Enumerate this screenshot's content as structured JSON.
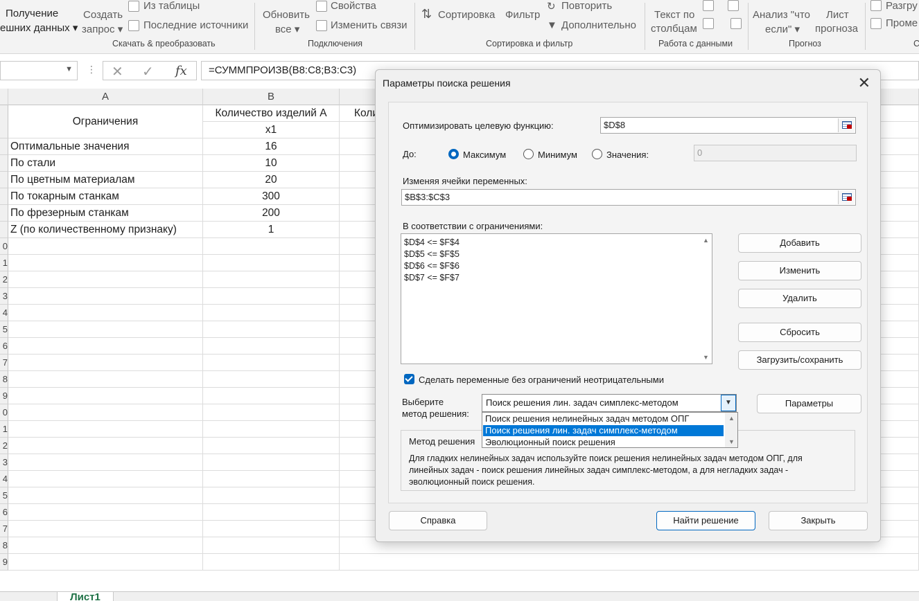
{
  "ribbon": {
    "get_data_line1": "Получение",
    "get_data_line2": "ешних данных",
    "create_query_line1": "Создать",
    "create_query_line2": "запрос",
    "from_table": "Из таблицы",
    "recent_sources": "Последние источники",
    "group_get_transform": "Скачать & преобразовать",
    "refresh_line1": "Обновить",
    "refresh_line2": "все",
    "properties": "Свойства",
    "edit_links": "Изменить связи",
    "group_connections": "Подключения",
    "sort": "Сортировка",
    "filter": "Фильтр",
    "reapply": "Повторить",
    "advanced": "Дополнительно",
    "group_sort_filter": "Сортировка и фильтр",
    "text_to_columns_line1": "Текст по",
    "text_to_columns_line2": "столбцам",
    "group_data_tools": "Работа с данными",
    "whatif_line1": "Анализ \"что",
    "whatif_line2": "если\"",
    "forecast_line1": "Лист",
    "forecast_line2": "прогноза",
    "group_forecast": "Прогноз",
    "ungroup": "Разгру",
    "subtotal": "Проме",
    "group_outline": "С"
  },
  "formula_bar": {
    "formula": "=СУММПРОИЗВ(B8:C8;B3:C3)",
    "fx": "fx"
  },
  "sheet": {
    "col_a": "A",
    "col_b": "B",
    "header_a": "Ограничения",
    "header_b": "Количество изделий А",
    "header_c_partial": "Коли",
    "var_b": "x1",
    "rows": [
      {
        "label": "Оптимальные значения",
        "value": "16"
      },
      {
        "label": "По стали",
        "value": "10"
      },
      {
        "label": "По цветным материалам",
        "value": "20"
      },
      {
        "label": "По токарным станкам",
        "value": "300"
      },
      {
        "label": "По фрезерным станкам",
        "value": "200"
      },
      {
        "label": "Z (по количественному признаку)",
        "value": "1"
      }
    ],
    "row_numbers": [
      "0",
      "1",
      "2",
      "3",
      "4",
      "5",
      "6",
      "7",
      "8",
      "9",
      "0",
      "1",
      "2",
      "3",
      "4",
      "5",
      "6",
      "7",
      "8",
      "9"
    ],
    "tab_name": "Лист1"
  },
  "dialog": {
    "title": "Параметры поиска решения",
    "objective_label": "Оптимизировать целевую функцию:",
    "objective_value": "$D$8",
    "to_label": "До:",
    "radio_max": "Максимум",
    "radio_min": "Минимум",
    "radio_value": "Значения:",
    "value_field": "0",
    "changing_label": "Изменяя ячейки переменных:",
    "changing_value": "$B$3:$C$3",
    "constraints_label": "В соответствии с ограничениями:",
    "constraints": [
      "$D$4 <= $F$4",
      "$D$5 <= $F$5",
      "$D$6 <= $F$6",
      "$D$7 <= $F$7"
    ],
    "btn_add": "Добавить",
    "btn_change": "Изменить",
    "btn_delete": "Удалить",
    "btn_reset": "Сбросить",
    "btn_load_save": "Загрузить/сохранить",
    "nonneg_label": "Сделать переменные без ограничений неотрицательными",
    "method_label_line1": "Выберите",
    "method_label_line2": "метод решения:",
    "method_selected": "Поиск решения лин. задач симплекс-методом",
    "method_options": [
      "Поиск решения нелинейных задач методом ОПГ",
      "Поиск решения лин. задач симплекс-методом",
      "Эволюционный поиск решения"
    ],
    "btn_options": "Параметры",
    "method_group_title": "Метод решения",
    "method_desc": "Для гладких нелинейных задач используйте поиск решения нелинейных задач методом ОПГ, для линейных задач - поиск решения линейных задач симплекс-методом, а для негладких задач - эволюционный поиск решения.",
    "btn_help": "Справка",
    "btn_solve": "Найти решение",
    "btn_close": "Закрыть"
  }
}
